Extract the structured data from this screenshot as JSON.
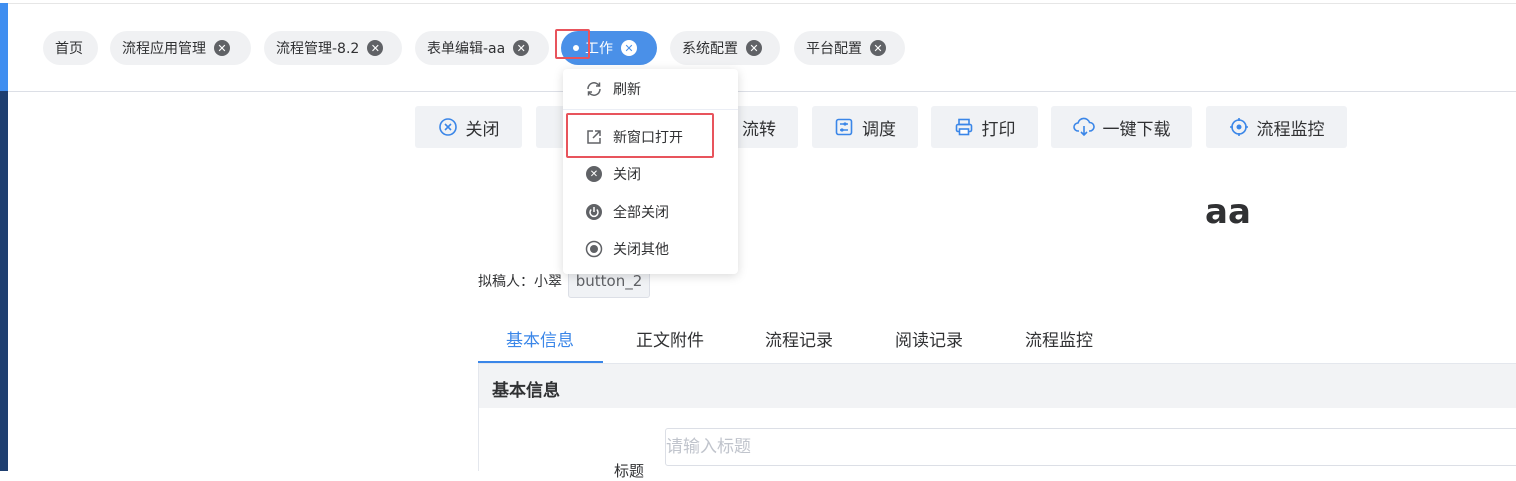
{
  "tabs": [
    {
      "label": "首页",
      "closable": false
    },
    {
      "label": "流程应用管理",
      "closable": true
    },
    {
      "label": "流程管理-8.2",
      "closable": true
    },
    {
      "label": "表单编辑-aa",
      "closable": true
    },
    {
      "label": "工作",
      "closable": true,
      "active": true
    },
    {
      "label": "系统配置",
      "closable": true
    },
    {
      "label": "平台配置",
      "closable": true
    }
  ],
  "context_menu": {
    "items": [
      {
        "label": "刷新",
        "icon": "refresh-icon"
      },
      {
        "label": "新窗口打开",
        "icon": "open-new-window-icon",
        "highlighted": true
      },
      {
        "label": "关闭",
        "icon": "close-circle-icon"
      },
      {
        "label": "全部关闭",
        "icon": "power-icon"
      },
      {
        "label": "关闭其他",
        "icon": "radio-dot-icon"
      }
    ]
  },
  "toolbar": {
    "close": "关闭",
    "transfer_partial": "流转",
    "schedule": "调度",
    "print": "打印",
    "download": "一键下载",
    "monitor": "流程监控"
  },
  "document": {
    "title": "aa",
    "drafter_label": "拟稿人：",
    "drafter_name": "小翠",
    "custom_button": "button_2"
  },
  "subtabs": [
    "基本信息",
    "正文附件",
    "流程记录",
    "阅读记录",
    "流程监控"
  ],
  "form": {
    "section_title": "基本信息",
    "title_label": "标题",
    "title_placeholder": "请输入标题"
  },
  "colors": {
    "accent": "#3a86e8",
    "active_tab": "#4a90e8",
    "highlight_border": "#e8545c"
  }
}
